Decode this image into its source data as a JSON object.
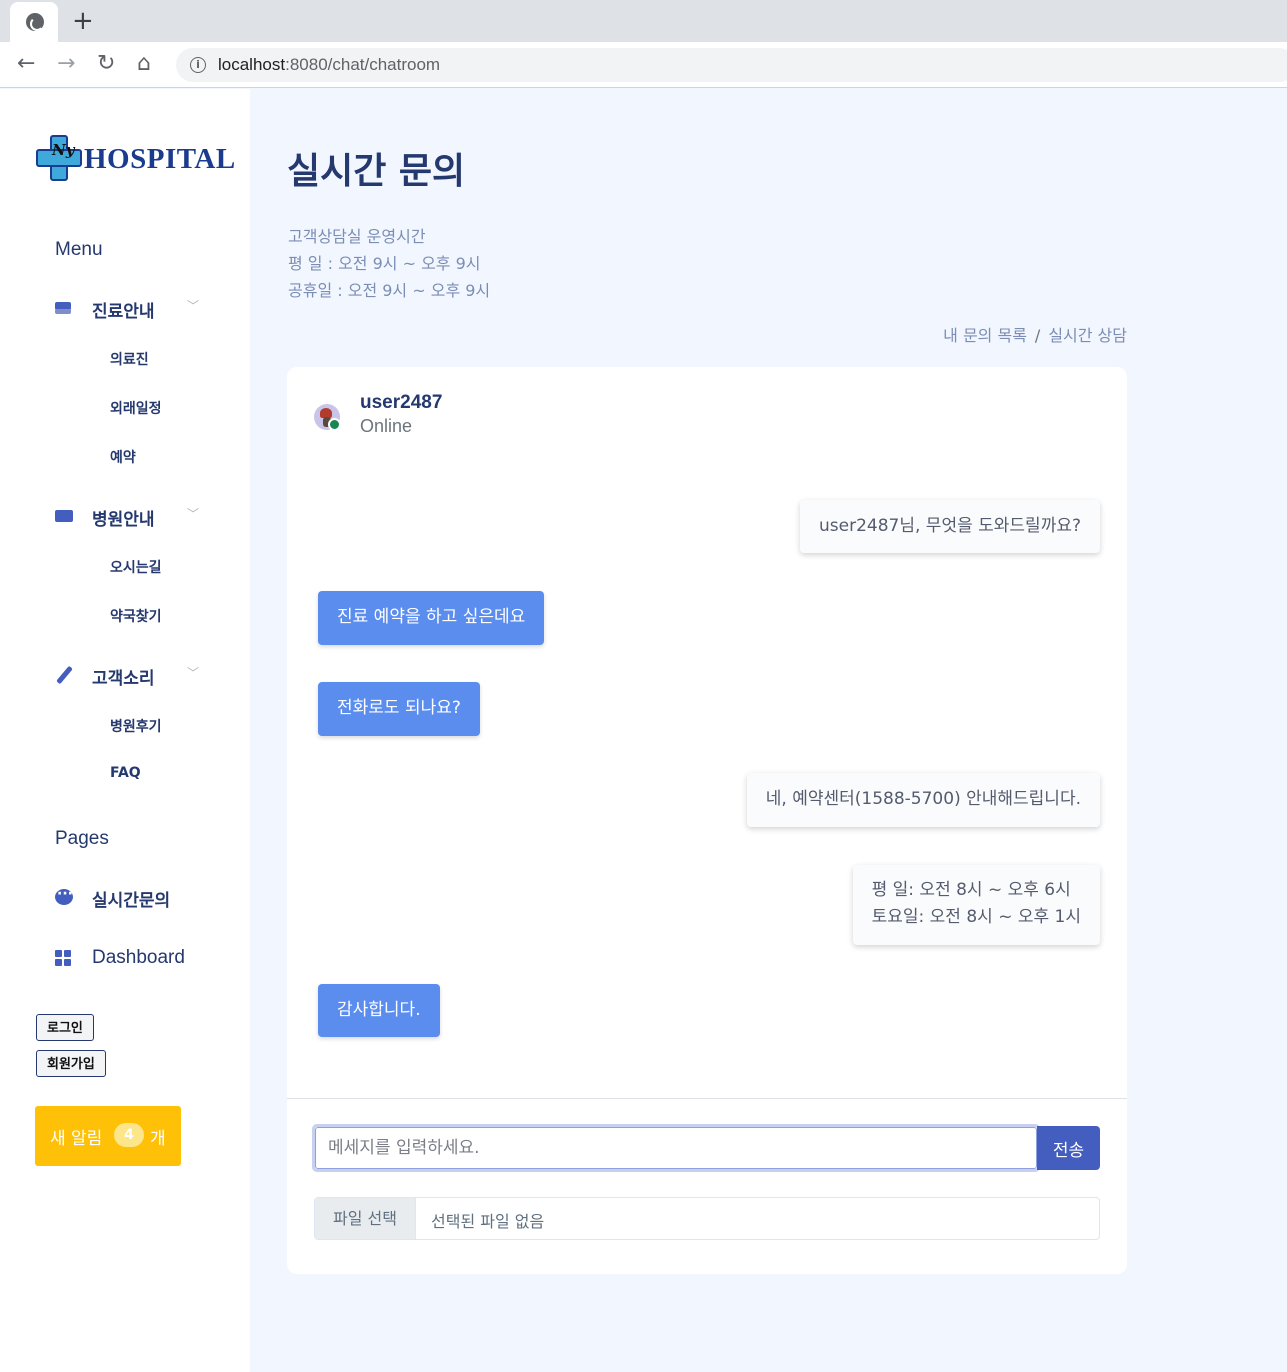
{
  "browser": {
    "url_host": "localhost",
    "url_path": ":8080/chat/chatroom",
    "new_tab": "+",
    "back": "←",
    "forward": "→",
    "reload": "↻",
    "home": "⌂",
    "info": "i"
  },
  "sidebar": {
    "logo_text": "HOSPITAL",
    "logo_ny": "Ny",
    "menu_title": "Menu",
    "groups": [
      {
        "label": "진료안내",
        "children": [
          "의료진",
          "외래일정",
          "예약"
        ]
      },
      {
        "label": "병원안내",
        "children": [
          "오시는길",
          "약국찾기"
        ]
      },
      {
        "label": "고객소리",
        "children": [
          "병원후기",
          "FAQ"
        ]
      }
    ],
    "pages_title": "Pages",
    "pages": [
      {
        "label": "실시간문의"
      },
      {
        "label": "Dashboard"
      }
    ],
    "login": "로그인",
    "signup": "회원가입",
    "notify": {
      "prefix": "새 알림",
      "count": "4",
      "suffix": "개",
      "color": "#ffc107"
    }
  },
  "main": {
    "title": "실시간 문의",
    "hours": {
      "heading": "고객상담실 운영시간",
      "weekday": "평 일 : 오전 9시 ~ 오후 9시",
      "holiday": "공휴일 : 오전 9시 ~ 오후 9시"
    },
    "breadcrumb": [
      "내 문의 목록",
      "/",
      "실시간 상담"
    ]
  },
  "chat": {
    "user": {
      "name": "user2487",
      "status": "Online"
    },
    "messages": [
      {
        "side": "right",
        "text": "user2487님, 무엇을 도와드릴까요?"
      },
      {
        "side": "left",
        "text": "진료 예약을 하고 싶은데요"
      },
      {
        "side": "left",
        "text": "전화로도 되나요?"
      },
      {
        "side": "right",
        "text": "네, 예약센터(1588-5700) 안내해드립니다."
      },
      {
        "side": "right",
        "text": "평 일: 오전 8시 ~ 오후 6시",
        "text2": "토요일: 오전 8시 ~ 오후 1시"
      },
      {
        "side": "left",
        "text": "감사합니다."
      }
    ],
    "input_placeholder": "메세지를 입력하세요.",
    "send_label": "전송",
    "file_button": "파일 선택",
    "file_status": "선택된 파일 없음"
  },
  "colors": {
    "primary": "#435ebe",
    "bubble_left": "#5b8def",
    "online": "#198754"
  }
}
